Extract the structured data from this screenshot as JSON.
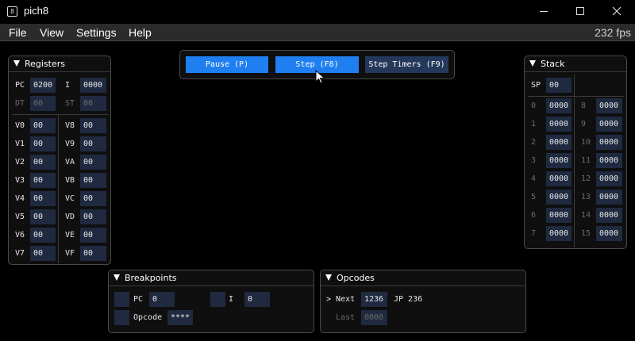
{
  "window": {
    "title": "pich8",
    "icon_glyph": "8"
  },
  "menu": {
    "items": [
      "File",
      "View",
      "Settings",
      "Help"
    ],
    "fps": "232 fps"
  },
  "toolbar": {
    "pause": "Pause (P)",
    "step": "Step (F8)",
    "step_timers": "Step Timers (F9)"
  },
  "registers": {
    "title": "Registers",
    "pc": {
      "label": "PC",
      "value": "0200"
    },
    "i": {
      "label": "I",
      "value": "0000"
    },
    "dt": {
      "label": "DT",
      "value": "00"
    },
    "st": {
      "label": "ST",
      "value": "00"
    },
    "left": [
      {
        "label": "V0",
        "value": "00"
      },
      {
        "label": "V1",
        "value": "00"
      },
      {
        "label": "V2",
        "value": "00"
      },
      {
        "label": "V3",
        "value": "00"
      },
      {
        "label": "V4",
        "value": "00"
      },
      {
        "label": "V5",
        "value": "00"
      },
      {
        "label": "V6",
        "value": "00"
      },
      {
        "label": "V7",
        "value": "00"
      }
    ],
    "right": [
      {
        "label": "V8",
        "value": "00"
      },
      {
        "label": "V9",
        "value": "00"
      },
      {
        "label": "VA",
        "value": "00"
      },
      {
        "label": "VB",
        "value": "00"
      },
      {
        "label": "VC",
        "value": "00"
      },
      {
        "label": "VD",
        "value": "00"
      },
      {
        "label": "VE",
        "value": "00"
      },
      {
        "label": "VF",
        "value": "00"
      }
    ]
  },
  "stack": {
    "title": "Stack",
    "sp": {
      "label": "SP",
      "value": "00"
    },
    "left": [
      {
        "label": "0",
        "value": "0000"
      },
      {
        "label": "1",
        "value": "0000"
      },
      {
        "label": "2",
        "value": "0000"
      },
      {
        "label": "3",
        "value": "0000"
      },
      {
        "label": "4",
        "value": "0000"
      },
      {
        "label": "5",
        "value": "0000"
      },
      {
        "label": "6",
        "value": "0000"
      },
      {
        "label": "7",
        "value": "0000"
      }
    ],
    "right": [
      {
        "label": "8",
        "value": "0000"
      },
      {
        "label": "9",
        "value": "0000"
      },
      {
        "label": "10",
        "value": "0000"
      },
      {
        "label": "11",
        "value": "0000"
      },
      {
        "label": "12",
        "value": "0000"
      },
      {
        "label": "13",
        "value": "0000"
      },
      {
        "label": "14",
        "value": "0000"
      },
      {
        "label": "15",
        "value": "0000"
      }
    ]
  },
  "breakpoints": {
    "title": "Breakpoints",
    "pc": {
      "label": "PC",
      "value": "0"
    },
    "i": {
      "label": "I",
      "value": "0"
    },
    "opcode": {
      "label": "Opcode",
      "value": "****"
    }
  },
  "opcodes": {
    "title": "Opcodes",
    "next": {
      "label": "> Next",
      "value": "1236",
      "disasm": "JP 236"
    },
    "last": {
      "label": "Last",
      "value": "0000"
    }
  },
  "colors": {
    "accent": "#1f7ff0",
    "field_bg": "#1f2a40",
    "panel_bg": "#0f0f0f"
  }
}
